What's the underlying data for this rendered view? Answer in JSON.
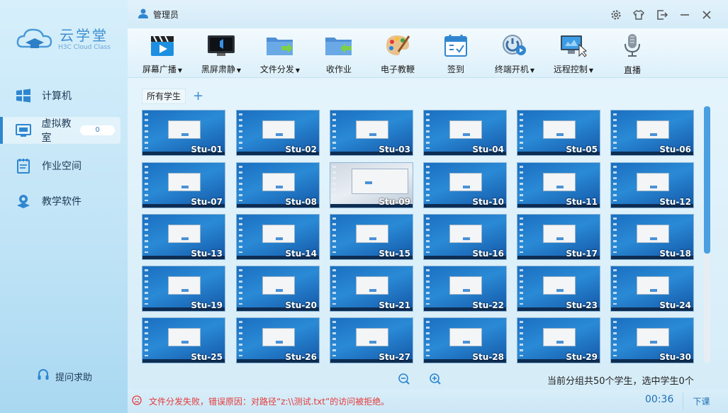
{
  "app": {
    "name_cn": "云学堂",
    "name_en": "H3C Cloud Class"
  },
  "sidebar": {
    "items": [
      {
        "label": "计算机",
        "icon": "windows-icon"
      },
      {
        "label": "虚拟教室",
        "icon": "classroom-icon",
        "badge": "0",
        "active": true
      },
      {
        "label": "作业空间",
        "icon": "homework-icon"
      },
      {
        "label": "教学软件",
        "icon": "software-icon"
      }
    ],
    "help_label": "提问求助"
  },
  "topbar": {
    "user": "管理员"
  },
  "toolbar": [
    {
      "label": "屏幕广播",
      "dropdown": true,
      "icon": "broadcast-icon"
    },
    {
      "label": "黑屏肃静",
      "dropdown": true,
      "icon": "blackscreen-icon"
    },
    {
      "label": "文件分发",
      "dropdown": true,
      "icon": "file-send-icon"
    },
    {
      "label": "收作业",
      "dropdown": false,
      "icon": "collect-homework-icon"
    },
    {
      "label": "电子教鞭",
      "dropdown": false,
      "icon": "palette-icon"
    },
    {
      "label": "签到",
      "dropdown": false,
      "icon": "checkin-icon"
    },
    {
      "label": "终端开机",
      "dropdown": true,
      "icon": "power-icon"
    },
    {
      "label": "远程控制",
      "dropdown": true,
      "icon": "remote-control-icon"
    },
    {
      "label": "直播",
      "dropdown": false,
      "icon": "microphone-icon"
    }
  ],
  "tabs": {
    "active": "所有学生",
    "add_symbol": "+"
  },
  "students": [
    "Stu-01",
    "Stu-02",
    "Stu-03",
    "Stu-04",
    "Stu-05",
    "Stu-06",
    "Stu-07",
    "Stu-08",
    "Stu-09",
    "Stu-10",
    "Stu-11",
    "Stu-12",
    "Stu-13",
    "Stu-14",
    "Stu-15",
    "Stu-16",
    "Stu-17",
    "Stu-18",
    "Stu-19",
    "Stu-20",
    "Stu-21",
    "Stu-22",
    "Stu-23",
    "Stu-24",
    "Stu-25",
    "Stu-26",
    "Stu-27",
    "Stu-28",
    "Stu-29",
    "Stu-30"
  ],
  "summary": "当前分组共50个学生，选中学生0个",
  "status": {
    "error": "文件分发失败，错误原因：对路径“z:\\\\测试.txt”的访问被拒绝。",
    "timer": "00:36",
    "end_class": "下课"
  },
  "colors": {
    "accent": "#2f86d0",
    "error": "#e5393a",
    "scroll": "#4a9fe0"
  }
}
